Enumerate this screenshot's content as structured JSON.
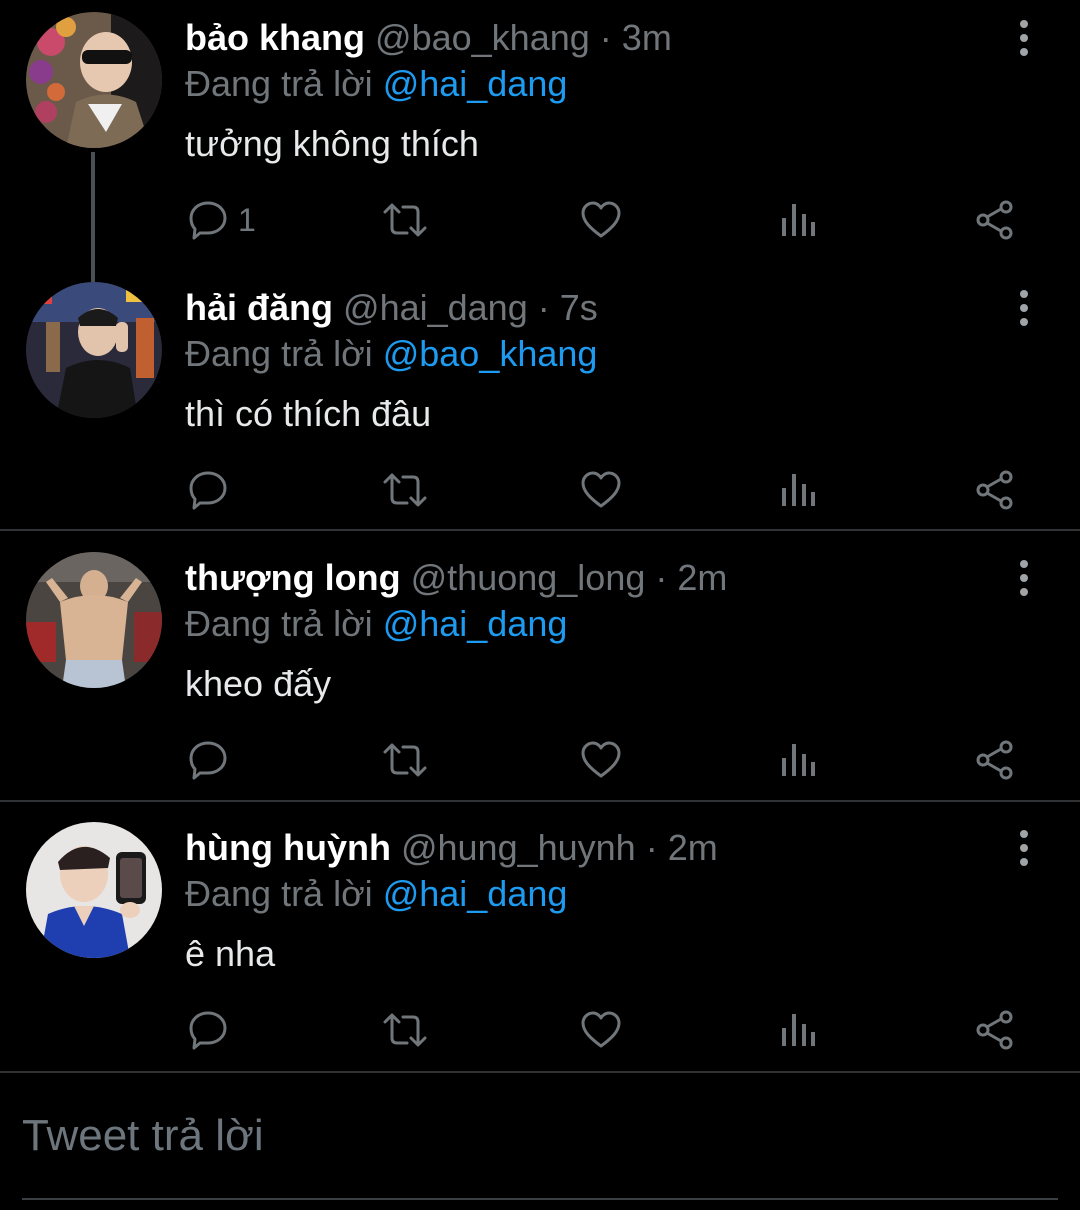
{
  "tweets": [
    {
      "name": "bảo khang",
      "handle": "@bao_khang",
      "separator": "·",
      "time": "3m",
      "replying_prefix": "Đang trả lời",
      "replying_to": "@hai_dang",
      "text": "tưởng không thích",
      "reply_count": "1"
    },
    {
      "name": "hải đăng",
      "handle": "@hai_dang",
      "separator": "·",
      "time": "7s",
      "replying_prefix": "Đang trả lời",
      "replying_to": "@bao_khang",
      "text": "thì có thích đâu",
      "reply_count": ""
    },
    {
      "name": "thượng long",
      "handle": "@thuong_long",
      "separator": "·",
      "time": "2m",
      "replying_prefix": "Đang trả lời",
      "replying_to": "@hai_dang",
      "text": "kheo đấy",
      "reply_count": ""
    },
    {
      "name": "hùng huỳnh",
      "handle": "@hung_huynh",
      "separator": "·",
      "time": "2m",
      "replying_prefix": "Đang trả lời",
      "replying_to": "@hai_dang",
      "text": "ê nha",
      "reply_count": ""
    }
  ],
  "icons": {
    "more": "more-vertical-icon",
    "reply": "reply-icon",
    "retweet": "retweet-icon",
    "like": "heart-icon",
    "views": "views-icon",
    "share": "share-icon"
  },
  "colors": {
    "background": "#000000",
    "mention": "#1d9bf0",
    "muted": "#71767b",
    "divider": "#2f3336"
  },
  "composer": {
    "placeholder": "Tweet trả lời"
  }
}
